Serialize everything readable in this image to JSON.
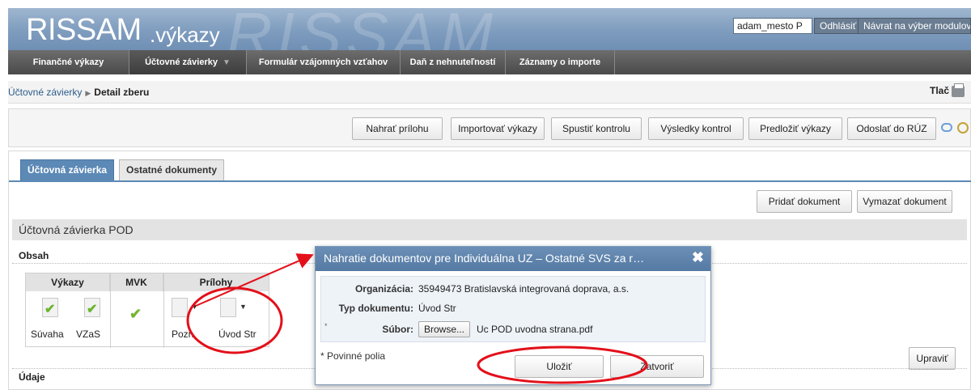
{
  "header": {
    "logo_main": "RISSAM",
    "logo_suffix": ".výkazy",
    "watermark": "RISSAM",
    "user": "adam_mesto P",
    "logout_label": "Odhlásiť",
    "back_label": "Návrat na výber modulov"
  },
  "nav": {
    "items": [
      {
        "label": "Finančné výkazy"
      },
      {
        "label": "Účtovné závierky"
      },
      {
        "label": "Formulár vzájomných vzťahov"
      },
      {
        "label": "Daň z nehnuteľností"
      },
      {
        "label": "Záznamy o importe"
      }
    ]
  },
  "breadcrumb": {
    "link": "Účtovné závierky",
    "current": "Detail zberu",
    "print_label": "Tlač"
  },
  "toolbar": {
    "buttons": [
      {
        "label": "Nahrať prílohu"
      },
      {
        "label": "Importovať výkazy"
      },
      {
        "label": "Spustiť kontrolu"
      },
      {
        "label": "Výsledky kontrol"
      },
      {
        "label": "Predložiť výkazy"
      },
      {
        "label": "Odoslať do RÚZ"
      }
    ]
  },
  "tabs": [
    {
      "label": "Účtovná závierka",
      "active": true
    },
    {
      "label": "Ostatné dokumenty",
      "active": false
    }
  ],
  "doc_actions": {
    "add_label": "Pridať dokument",
    "delete_label": "Vymazať dokument",
    "edit_label": "Upraviť"
  },
  "section": {
    "title": "Účtovná závierka POD",
    "obsah": "Obsah",
    "udaje": "Údaje"
  },
  "grid": {
    "headers": [
      "Výkazy",
      "MVK",
      "Prílohy"
    ],
    "vykazy": [
      "Súvaha",
      "VZaS"
    ],
    "prilohy": [
      "Pozn",
      "Úvod Str"
    ]
  },
  "dialog": {
    "title": "Nahratie dokumentov pre Individuálna UZ – Ostatné SVS za r…",
    "org_label": "Organizácia:",
    "org_value": "35949473 Bratislavská integrovaná doprava, a.s.",
    "type_label": "Typ dokumentu:",
    "type_value": "Úvod Str",
    "file_label": "Súbor:",
    "browse_label": "Browse...",
    "file_value": "Uc POD uvodna strana.pdf",
    "required_note": "* Povinné polia",
    "required_star": "*",
    "save_label": "Uložiť",
    "close_label": "Zatvoriť"
  },
  "colors": {
    "accent": "#5c89b6",
    "annotation": "#e3101a",
    "check": "#6ab52c"
  }
}
